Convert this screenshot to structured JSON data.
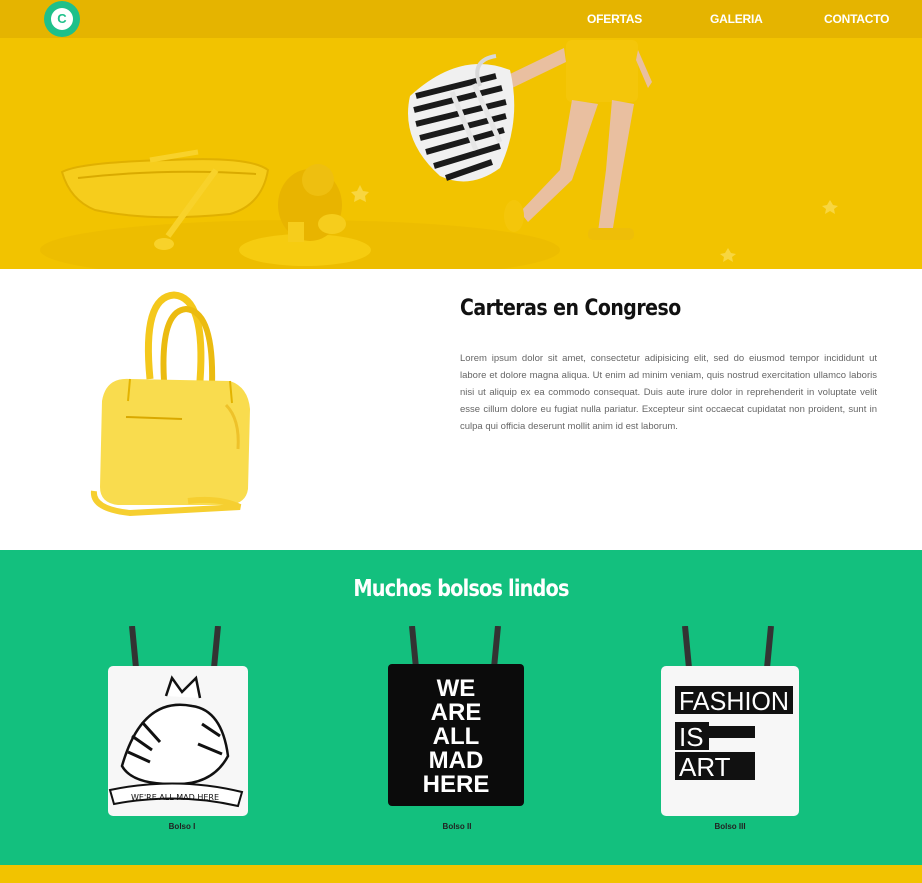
{
  "nav": {
    "logo_letter": "C",
    "links": [
      "OFERTAS",
      "GALERIA",
      "CONTACTO"
    ]
  },
  "about": {
    "title": "Carteras en Congreso",
    "body": "Lorem ipsum dolor sit amet, consectetur adipisicing elit, sed do eiusmod tempor incididunt ut labore et dolore magna aliqua. Ut enim ad minim veniam, quis nostrud exercitation ullamco laboris nisi ut aliquip ex ea commodo consequat. Duis aute irure dolor in reprehenderit in voluptate velit esse cillum dolore eu fugiat nulla pariatur. Excepteur sint occaecat cupidatat non proident, sunt in culpa qui officia deserunt mollit anim id est laborum."
  },
  "gallery": {
    "title": "Muchos bolsos lindos",
    "bags": [
      {
        "caption": "Bolso I",
        "print_text": "WE'RE ALL MAD HERE"
      },
      {
        "caption": "Bolso II",
        "print_lines": [
          "WE",
          "ARE",
          "ALL",
          "MAD",
          "HERE"
        ]
      },
      {
        "caption": "Bolso III",
        "print_lines": [
          "FASHION",
          "IS",
          "ART"
        ]
      }
    ]
  },
  "colors": {
    "yellow": "#f2c300",
    "nav_yellow": "#e5b400",
    "green": "#13c07e"
  }
}
